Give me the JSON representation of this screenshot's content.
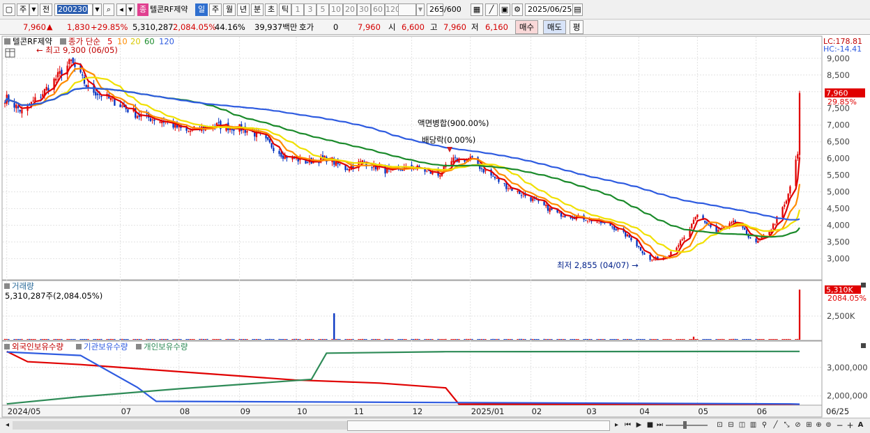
{
  "toolbar": {
    "period_main": "주",
    "prefix": "전",
    "code": "200230",
    "badge": "종",
    "stock_name": "텔콘RF제약",
    "tabs": [
      "일",
      "주",
      "월",
      "년",
      "분",
      "초",
      "틱"
    ],
    "active_tab": "일",
    "numbers": [
      "1",
      "3",
      "5",
      "10",
      "20",
      "30",
      "60",
      "120"
    ],
    "count": "265",
    "count_total": "/600",
    "date": "2025/06/25"
  },
  "quote": {
    "price": "7,960",
    "change": "1,830",
    "change_pct": "+29.85%",
    "volume": "5,310,287",
    "volume_pct": "2,084.05%",
    "turnover_pct": "44.16%",
    "amount": "39,937백만",
    "hoga_label": "호가",
    "hoga_value": "0",
    "last": "7,960",
    "open_label": "시",
    "open": "6,600",
    "high_label": "고",
    "high": "7,960",
    "low_label": "저",
    "low": "6,160",
    "buy_label": "매수",
    "sell_label": "매도",
    "eval_label": "평"
  },
  "chart_labels": {
    "legend_name": "텔콘RF제약",
    "legend_price": "종가 단순",
    "ma_periods": [
      "5",
      "10",
      "20",
      "60",
      "120"
    ],
    "max_note": "최고 9,300 (06/05)",
    "min_note": "최저 2,855 (04/07)",
    "event1": "액면병합(900.00%)",
    "event2": "배당락(0.00%)",
    "lc": "LC:178.81",
    "hc": "HC:-14.41",
    "last_tag": "7,960",
    "last_pct": "29.85%",
    "volume_title": "거래량",
    "volume_value": "5,310,287주(2,084.05%)",
    "volume_tag": "5,310K",
    "volume_tag_pct": "2084.05%",
    "holdings_foreign": "외국인보유수량",
    "holdings_inst": "기관보유수량",
    "holdings_indiv": "개인보유수량"
  },
  "colors": {
    "up": "#e00000",
    "down": "#0030c0",
    "ma5": "#e00000",
    "ma10": "#ff8c00",
    "ma20": "#f0e000",
    "ma60": "#1a8a2a",
    "ma120": "#2e5be0",
    "foreign": "#e00000",
    "inst": "#2e5be0",
    "indiv": "#2e8b57"
  },
  "chart_data": [
    {
      "type": "line",
      "title": "텔콘RF제약 종가 단순",
      "y_ticks": [
        3000,
        3500,
        4000,
        4500,
        5000,
        5500,
        6000,
        6500,
        7000,
        7500,
        8000,
        8500,
        9000
      ],
      "ylim": [
        2450,
        9600
      ],
      "x_ticks": [
        "2024/05",
        "07",
        "08",
        "09",
        "10",
        "11",
        "12",
        "2025/01",
        "02",
        "03",
        "04",
        "05",
        "06",
        "06/25"
      ],
      "close_anchors": [
        [
          "2024/05/02",
          7800
        ],
        [
          "2024/05/10",
          7400
        ],
        [
          "2024/05/20",
          7900
        ],
        [
          "2024/06/05",
          8900
        ],
        [
          "2024/06/14",
          8100
        ],
        [
          "2024/06/28",
          7700
        ],
        [
          "2024/07/10",
          7300
        ],
        [
          "2024/07/25",
          7100
        ],
        [
          "2024/08/05",
          6800
        ],
        [
          "2024/08/20",
          7000
        ],
        [
          "2024/09/03",
          6900
        ],
        [
          "2024/09/12",
          6700
        ],
        [
          "2024/09/25",
          6100
        ],
        [
          "2024/10/07",
          5900
        ],
        [
          "2024/10/18",
          6000
        ],
        [
          "2024/10/28",
          5700
        ],
        [
          "2024/11/06",
          5900
        ],
        [
          "2024/11/20",
          5600
        ],
        [
          "2024/12/03",
          5750
        ],
        [
          "2024/12/16",
          5500
        ],
        [
          "2024/12/24",
          5950
        ],
        [
          "2025/01/02",
          6000
        ],
        [
          "2025/01/09",
          5650
        ],
        [
          "2025/01/20",
          5200
        ],
        [
          "2025/02/03",
          4800
        ],
        [
          "2025/02/17",
          4350
        ],
        [
          "2025/03/04",
          4200
        ],
        [
          "2025/03/17",
          4000
        ],
        [
          "2025/03/28",
          3600
        ],
        [
          "2025/04/07",
          2950
        ],
        [
          "2025/04/15",
          3050
        ],
        [
          "2025/04/25",
          3600
        ],
        [
          "2025/05/02",
          4300
        ],
        [
          "2025/05/12",
          3800
        ],
        [
          "2025/05/22",
          4100
        ],
        [
          "2025/06/02",
          3450
        ],
        [
          "2025/06/10",
          3900
        ],
        [
          "2025/06/18",
          4700
        ],
        [
          "2025/06/24",
          6130
        ],
        [
          "2025/06/25",
          7960
        ]
      ],
      "series": [
        {
          "name": "5",
          "period": 5
        },
        {
          "name": "10",
          "period": 10
        },
        {
          "name": "20",
          "period": 20
        },
        {
          "name": "60",
          "period": 60
        },
        {
          "name": "120",
          "period": 120
        }
      ]
    },
    {
      "type": "bar",
      "title": "거래량",
      "y_ticks": [
        2500000
      ],
      "last_value": 5310287,
      "spikes": [
        [
          "2024/10/22",
          2800000
        ],
        [
          "2025/04/30",
          320000
        ],
        [
          "2025/06/25",
          5310287
        ]
      ]
    },
    {
      "type": "line",
      "y_ticks": [
        2000000,
        3000000
      ],
      "ylim": [
        1700000,
        3800000
      ],
      "series": [
        {
          "name": "외국인보유수량",
          "points": [
            [
              "2024/05/02",
              3560000
            ],
            [
              "2024/05/13",
              3200000
            ],
            [
              "2024/06/10",
              3100000
            ],
            [
              "2024/08/01",
              2850000
            ],
            [
              "2024/10/01",
              2560000
            ],
            [
              "2024/11/15",
              2450000
            ],
            [
              "2024/12/20",
              2280000
            ],
            [
              "2024/12/27",
              1710000
            ],
            [
              "2025/06/25",
              1710000
            ]
          ]
        },
        {
          "name": "기관보유수량",
          "points": [
            [
              "2024/05/02",
              3540000
            ],
            [
              "2024/06/10",
              3420000
            ],
            [
              "2024/07/10",
              2300000
            ],
            [
              "2024/07/20",
              1810000
            ],
            [
              "2025/06/20",
              1720000
            ],
            [
              "2025/06/25",
              1710000
            ]
          ]
        },
        {
          "name": "개인보유수량",
          "points": [
            [
              "2024/05/02",
              1720000
            ],
            [
              "2024/06/10",
              1970000
            ],
            [
              "2024/08/01",
              2250000
            ],
            [
              "2024/10/10",
              2580000
            ],
            [
              "2024/10/18",
              3500000
            ],
            [
              "2024/12/20",
              3550000
            ],
            [
              "2025/06/25",
              3560000
            ]
          ]
        }
      ]
    }
  ]
}
